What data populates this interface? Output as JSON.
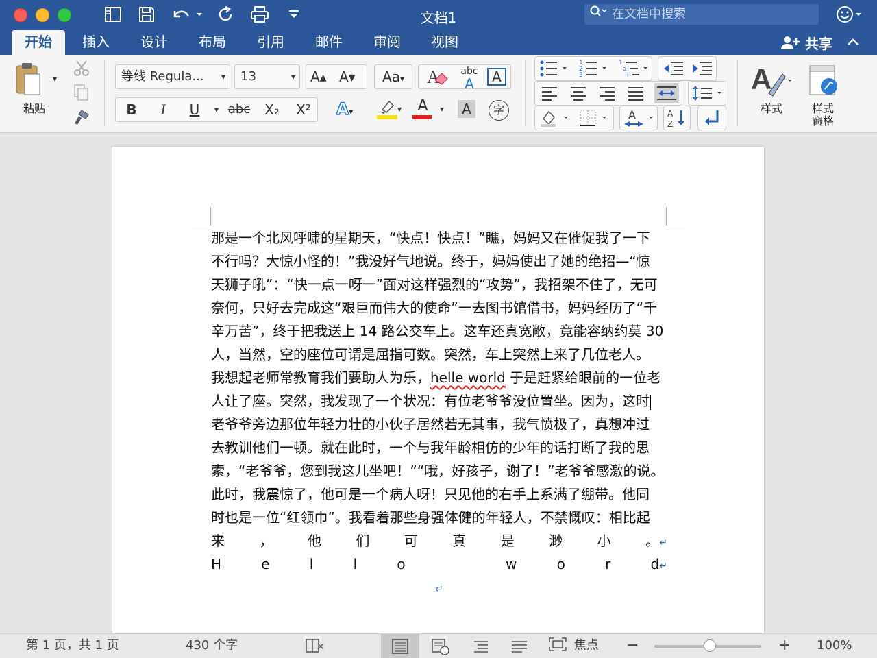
{
  "window": {
    "title": "文档1",
    "search_placeholder": "在文档中搜索"
  },
  "tabs": [
    {
      "label": "开始"
    },
    {
      "label": "插入"
    },
    {
      "label": "设计"
    },
    {
      "label": "布局"
    },
    {
      "label": "引用"
    },
    {
      "label": "邮件"
    },
    {
      "label": "审阅"
    },
    {
      "label": "视图"
    }
  ],
  "share_label": "共享",
  "ribbon": {
    "paste_label": "粘贴",
    "font_name": "等线 Regula...",
    "font_size": "13",
    "styles_label": "样式",
    "styles_pane_label_1": "样式",
    "styles_pane_label_2": "窗格",
    "bold": "B",
    "italic": "I",
    "underline": "U",
    "strike": "abc",
    "subscript": "X₂",
    "superscript": "X²",
    "grow_font": "A▴",
    "shrink_font": "A▾",
    "change_case": "Aa",
    "text_effects": "A",
    "font_color": "A",
    "char_shading": "A",
    "phonetic": "字",
    "abc_label": "abc",
    "abc_a": "A",
    "boxed_a": "A",
    "highlight_color": "#f7e11b",
    "font_color_value": "#e02020"
  },
  "document": {
    "lines": [
      "那是一个北风呼啸的星期天，“快点！快点！”瞧，妈妈又在催促我了一下",
      "不行吗？大惊小怪的！”我没好气地说。终于，妈妈使出了她的绝招—“惊",
      "天狮子吼”：“快一点一呀一”面对这样强烈的“攻势”，我招架不住了，无可",
      "奈何，只好去完成这“艰巨而伟大的使命”一去图书馆借书，妈妈经历了“千",
      "辛万苦”，终于把我送上 14 路公交车上。这车还真宽敞，竟能容纳约莫 30",
      "人，当然，空的座位可谓是屈指可数。突然，车上突然上来了几位老人。"
    ],
    "line7_a": "我想起老师常教育我们要助人为乐，",
    "line7_b": "helle world",
    "line7_c": " 于是赶紧给眼前的一位老",
    "line8": "人让了座。突然，我发现了一个状况：有位老爷爷没位置坐。因为，这时",
    "lines_b": [
      "老爷爷旁边那位年轻力壮的小伙子居然若无其事，我气愤极了，真想冲过",
      "去教训他们一顿。就在此时，一个与我年龄相仿的少年的话打断了我的思",
      "索，“老爷爷，您到我这儿坐吧！”“哦，好孩子，谢了！”老爷爷感激的说。",
      "此时，我震惊了，他可是一个病人呀！只见他的右手上系满了绷带。他同",
      "时也是一位“红领巾”。我看着那些身强体健的年轻人，不禁慨叹：相比起"
    ],
    "spread1": [
      "来",
      "，",
      "他",
      "们",
      "可",
      "真",
      "是",
      "渺",
      "小",
      "。"
    ],
    "spread2": [
      "H",
      "e",
      "l",
      "l",
      "o",
      "",
      "w",
      "o",
      "r",
      "d"
    ]
  },
  "status": {
    "page": "第 1 页，共 1 页",
    "words": "430 个字",
    "focus": "焦点",
    "zoom": "100%",
    "zoom_value": 100
  }
}
